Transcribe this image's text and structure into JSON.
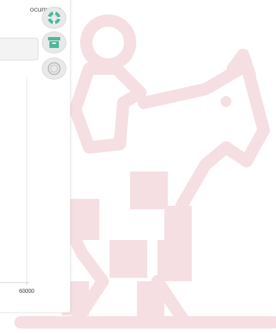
{
  "panel": {
    "documents_label": "ocumentos"
  },
  "chart_data": {
    "type": "bar",
    "categories": [],
    "values": [],
    "title": "",
    "xlabel": "",
    "ylabel": "",
    "x_tick_labels": [
      "60000"
    ],
    "grid": true
  },
  "toolbar": {
    "buttons": [
      {
        "icon": "lifebuoy-icon",
        "color": "#4fb89c"
      },
      {
        "icon": "archive-box-icon",
        "color": "#4fb89c"
      },
      {
        "icon": "circle-arrow-icon",
        "color": "#b5b5b5"
      }
    ]
  },
  "colors": {
    "watermark": "#f5dfe2",
    "accent": "#4fb89c"
  }
}
